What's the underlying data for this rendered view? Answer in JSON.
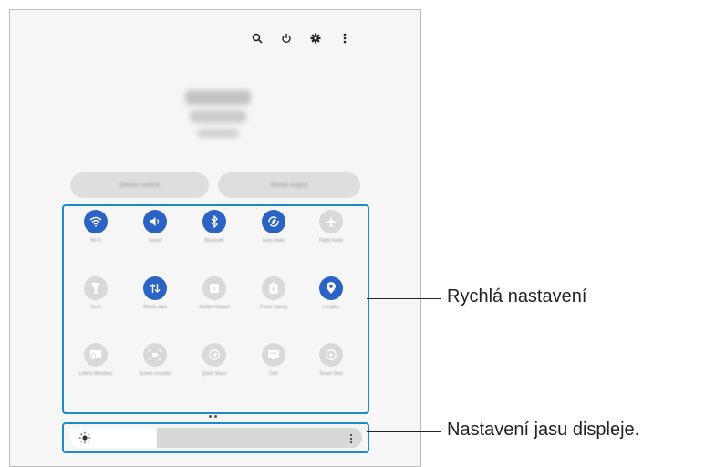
{
  "topbar": {
    "icons": [
      "search-icon",
      "power-icon",
      "settings-icon",
      "more-vertical-icon"
    ]
  },
  "panel_buttons": {
    "left_label": "Device control",
    "right_label": "Media output"
  },
  "quick_settings": {
    "tiles": [
      {
        "label": "Wi-Fi",
        "icon": "wifi-icon",
        "state": "on"
      },
      {
        "label": "Sound",
        "icon": "sound-icon",
        "state": "on"
      },
      {
        "label": "Bluetooth",
        "icon": "bluetooth-icon",
        "state": "on"
      },
      {
        "label": "Auto rotate",
        "icon": "auto-rotate-icon",
        "state": "on"
      },
      {
        "label": "Flight mode",
        "icon": "airplane-icon",
        "state": "off"
      },
      {
        "label": "Torch",
        "icon": "flashlight-icon",
        "state": "off"
      },
      {
        "label": "Mobile data",
        "icon": "mobile-data-icon",
        "state": "on"
      },
      {
        "label": "Mobile Hotspot",
        "icon": "hotspot-icon",
        "state": "off"
      },
      {
        "label": "Power saving",
        "icon": "power-saving-icon",
        "state": "off"
      },
      {
        "label": "Location",
        "icon": "location-icon",
        "state": "on"
      },
      {
        "label": "Link to Windows",
        "icon": "link-to-windows-icon",
        "state": "off"
      },
      {
        "label": "Screen recorder",
        "icon": "screen-recorder-icon",
        "state": "off"
      },
      {
        "label": "Quick Share",
        "icon": "quick-share-icon",
        "state": "off"
      },
      {
        "label": "DeX",
        "icon": "dex-icon",
        "state": "off"
      },
      {
        "label": "Smart View",
        "icon": "smart-view-icon",
        "state": "off"
      }
    ]
  },
  "brightness": {
    "level": 0.3,
    "icon": "sun-icon"
  },
  "callouts": {
    "quick_settings": "Rychlá nastavení",
    "brightness": "Nastavení jasu displeje."
  },
  "colors": {
    "accent": "#2b63c4",
    "callout_border": "#1a8cc7"
  }
}
